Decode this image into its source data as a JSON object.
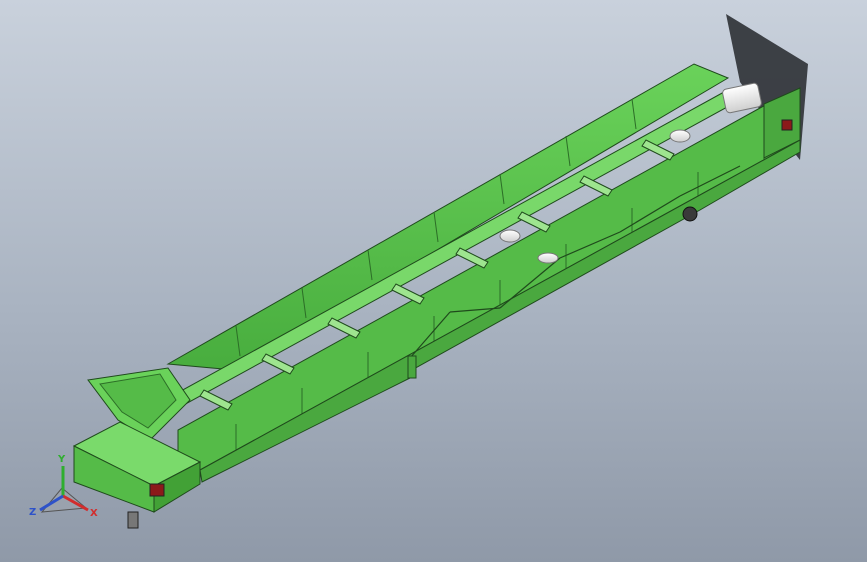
{
  "viewport": {
    "background_top": "#c9d1dc",
    "background_bottom": "#8f99a8"
  },
  "model": {
    "frame_color": "#5dc24f",
    "frame_dark": "#3f9a3a",
    "frame_edge": "#1f4a1c",
    "roller_color": "#f2f2f2",
    "chute_shadow": "#35383d"
  },
  "triad": {
    "x_label": "X",
    "y_label": "Y",
    "z_label": "Z",
    "x_color": "#d22d2d",
    "y_color": "#2fae2f",
    "z_color": "#2d52c9"
  }
}
